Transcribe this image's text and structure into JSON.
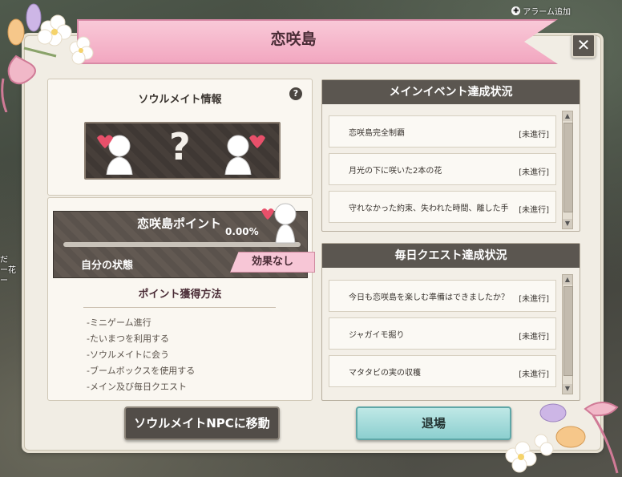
{
  "top_hint": {
    "label": "アラーム追加"
  },
  "left_overlay_text": [
    "だ",
    "ー花",
    "ー"
  ],
  "window": {
    "title": "恋咲島",
    "close_label": "✕"
  },
  "soulmate_info": {
    "title": "ソウルメイト情報",
    "help_label": "?",
    "unknown_label": "?"
  },
  "points": {
    "label": "恋咲島ポイント",
    "value_text": "0.00%",
    "progress_percent": 0,
    "state_label": "自分の状態",
    "state_value": "効果なし",
    "method_title": "ポイント獲得方法",
    "methods": [
      "-ミニゲーム進行",
      "-たいまつを利用する",
      "-ソウルメイトに会う",
      "-ブームボックスを使用する",
      "-メイン及び毎日クエスト"
    ]
  },
  "main_event": {
    "header": "メインイベント達成状況",
    "items": [
      {
        "text": "恋咲島完全制覇",
        "status": "[未進行]"
      },
      {
        "text": "月光の下に咲いた2本の花",
        "status": "[未進行]"
      },
      {
        "text": "守れなかった約束、失われた時間、離した手",
        "status": "[未進行]"
      }
    ]
  },
  "daily_quest": {
    "header": "毎日クエスト達成状況",
    "items": [
      {
        "text": "今日も恋咲島を楽しむ準備はできましたか？",
        "status": "[未進行]"
      },
      {
        "text": "ジャガイモ掘り",
        "status": "[未進行]"
      },
      {
        "text": "マタタビの実の収穫",
        "status": "[未進行]"
      }
    ]
  },
  "buttons": {
    "move_npc": "ソウルメイトNPCに移動",
    "exit": "退場"
  },
  "colors": {
    "banner_pink": "#f2a7c0",
    "header_dark": "#5b5650",
    "exit_button": "#8ccfcf",
    "badge_pink": "#f7c6d6"
  }
}
